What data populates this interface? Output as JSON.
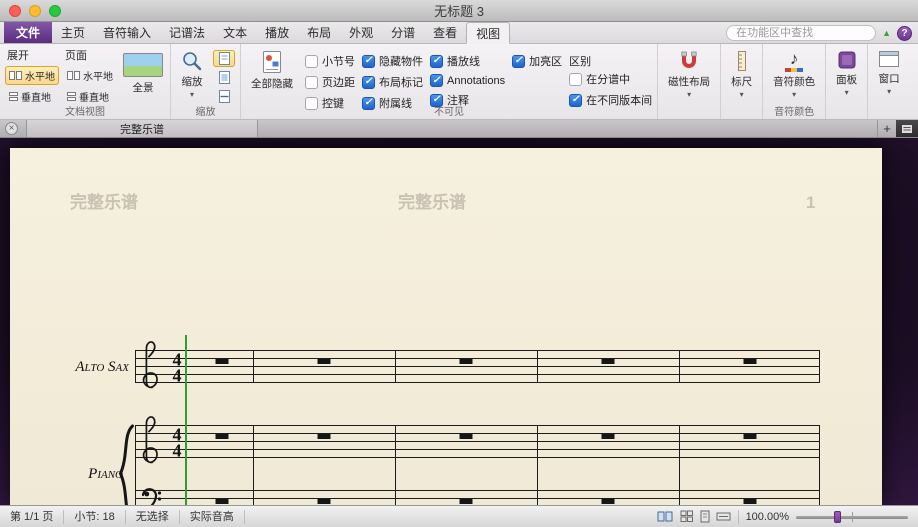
{
  "window": {
    "title": "无标题 3"
  },
  "icons": {
    "close": "×",
    "add": "+",
    "collapse": "▲",
    "help": "?",
    "dropdown": "▾",
    "check": "✓",
    "note": "♪"
  },
  "tabs": {
    "file": "文件",
    "items": [
      "主页",
      "音符输入",
      "记谱法",
      "文本",
      "播放",
      "布局",
      "外观",
      "分谱",
      "查看"
    ],
    "active": "视图"
  },
  "search": {
    "placeholder": "在功能区中查找"
  },
  "doc_view": {
    "group_label": "文档视图",
    "spreads_header": "展开",
    "pages_header": "页面",
    "horizontal": "水平地",
    "vertical": "垂直地",
    "panorama": "全景"
  },
  "zoom": {
    "group_label": "缩放",
    "button": "缩放"
  },
  "invisibles": {
    "group_label": "不可见",
    "hide_all": "全部隐藏",
    "col1": [
      {
        "label": "小节号",
        "checked": false
      },
      {
        "label": "页边距",
        "checked": false
      },
      {
        "label": "控键",
        "checked": false
      }
    ],
    "col2": [
      {
        "label": "隐藏物件",
        "checked": true
      },
      {
        "label": "布局标记",
        "checked": true
      },
      {
        "label": "附属线",
        "checked": true
      }
    ],
    "col3": [
      {
        "label": "播放线",
        "checked": true
      },
      {
        "label": "Annotations",
        "checked": true
      },
      {
        "label": "注释",
        "checked": true
      }
    ],
    "col4": [
      {
        "label": "加亮区",
        "checked": true
      }
    ],
    "diff_header": "区别",
    "diff": [
      {
        "label": "在分谱中",
        "checked": false
      },
      {
        "label": "在不同版本间",
        "checked": true
      }
    ]
  },
  "magnetic": {
    "label": "磁性布局"
  },
  "rulers": {
    "label": "标尺"
  },
  "note_colors": {
    "label": "音符颜色",
    "group_label": "音符颜色"
  },
  "panels": {
    "label": "面板"
  },
  "window_group": {
    "label": "窗口"
  },
  "doc_tabs": {
    "tab": "完整乐谱"
  },
  "score": {
    "watermark": "完整乐谱",
    "page_number": "1",
    "alto_label": "Alto Sax",
    "piano_label": "Piano",
    "timesig_top": "4",
    "timesig_bottom": "4"
  },
  "status": {
    "page": "第 1/1 页",
    "bars": "小节: 18",
    "selection": "无选择",
    "pitch": "实际音高",
    "zoom": "100.00%"
  }
}
